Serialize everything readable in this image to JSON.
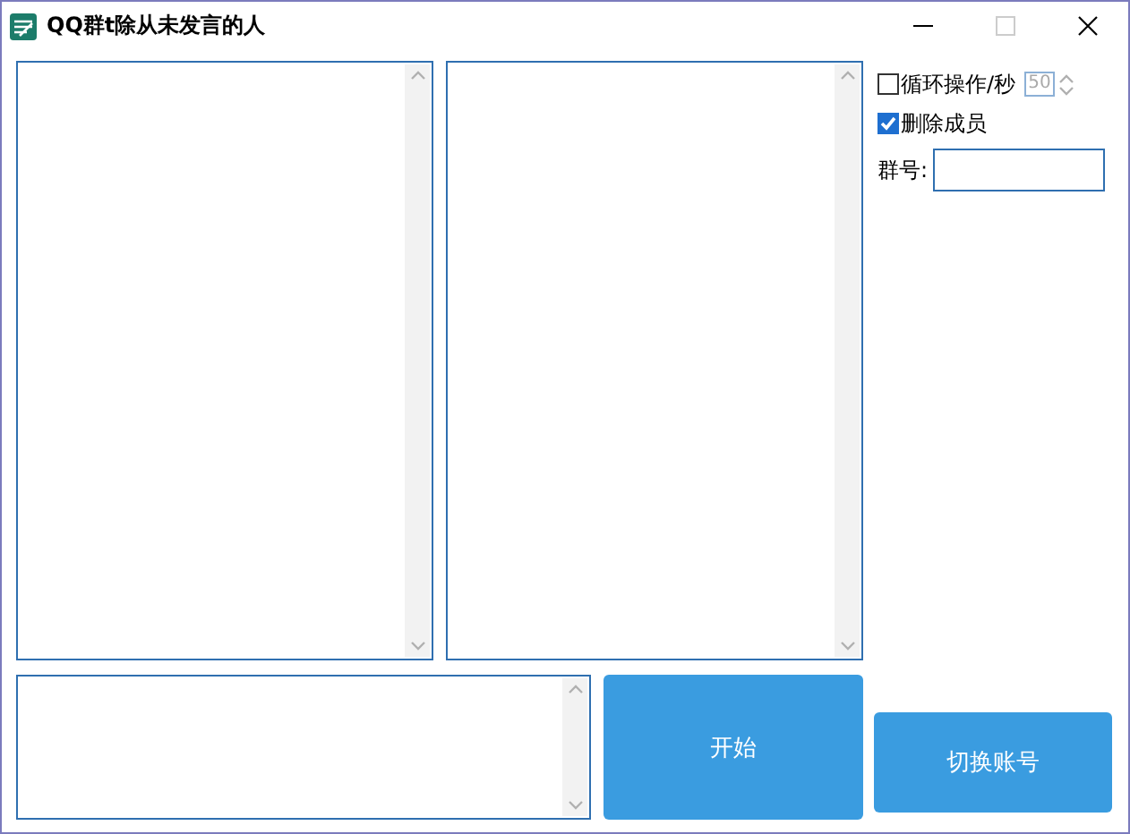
{
  "window": {
    "title": "QQ群t除从未发言的人"
  },
  "loop_option": {
    "label": "循环操作/秒",
    "checked": false,
    "interval": {
      "value": "50",
      "disabled": true
    }
  },
  "delete_option": {
    "label": "删除成员",
    "checked": true
  },
  "group_field": {
    "label": "群号:"
  },
  "buttons": [
    {
      "label": "开始"
    },
    {
      "label": "切换账号"
    }
  ]
}
